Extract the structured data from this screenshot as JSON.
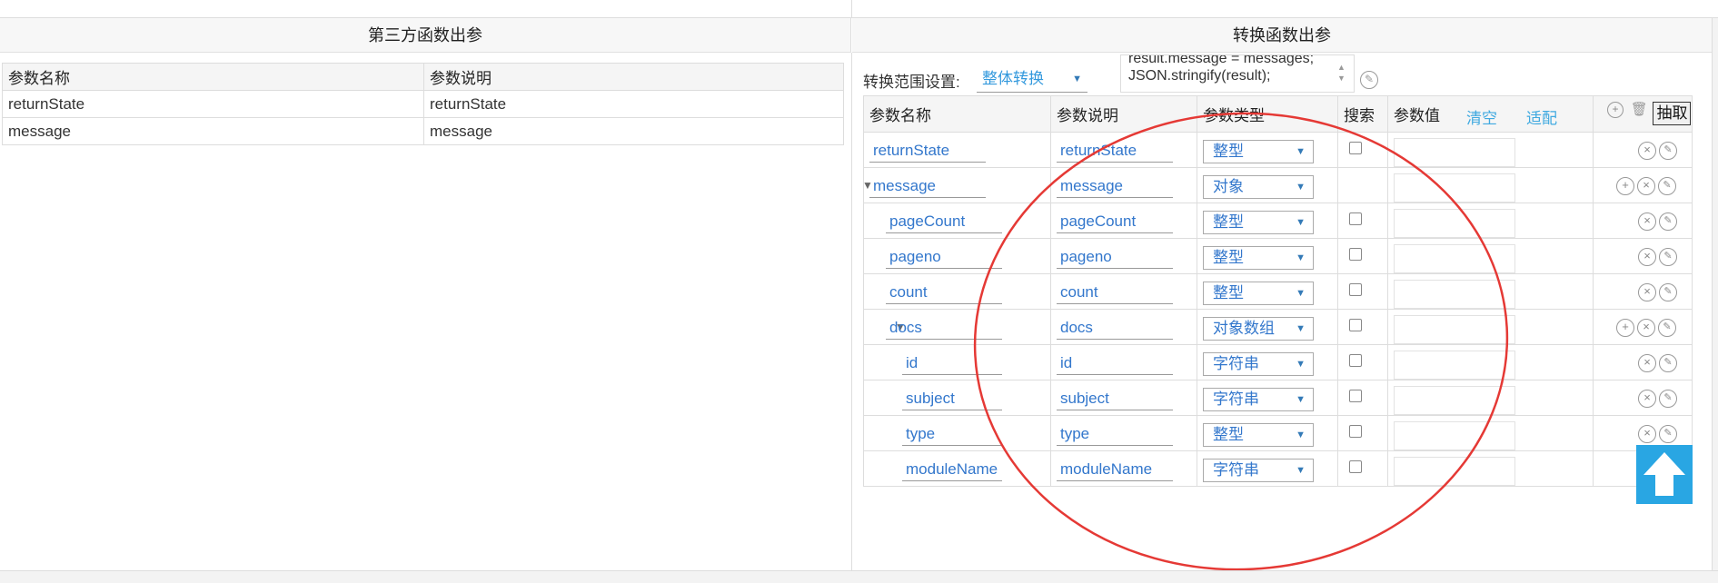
{
  "left_panel": {
    "title": "第三方函数出参",
    "columns": [
      "参数名称",
      "参数说明"
    ],
    "rows": [
      {
        "name": "returnState",
        "desc": "returnState"
      },
      {
        "name": "message",
        "desc": "message"
      }
    ]
  },
  "right_panel": {
    "title": "转换函数出参",
    "range_label": "转换范围设置:",
    "range_value": "整体转换",
    "code_line1": "result.message = messages;",
    "code_line2": "JSON.stringify(result);",
    "columns": {
      "name": "参数名称",
      "desc": "参数说明",
      "type": "参数类型",
      "search": "搜索",
      "value": "参数值",
      "clear": "清空",
      "fit": "适配",
      "extract": "抽取"
    },
    "rows": [
      {
        "name": "returnState",
        "desc": "returnState",
        "type": "整型",
        "has_checkbox": true,
        "can_add": false
      },
      {
        "name": "message",
        "desc": "message",
        "type": "对象",
        "has_checkbox": false,
        "can_add": true
      },
      {
        "name": "pageCount",
        "desc": "pageCount",
        "type": "整型",
        "has_checkbox": true,
        "can_add": false
      },
      {
        "name": "pageno",
        "desc": "pageno",
        "type": "整型",
        "has_checkbox": true,
        "can_add": false
      },
      {
        "name": "count",
        "desc": "count",
        "type": "整型",
        "has_checkbox": true,
        "can_add": false
      },
      {
        "name": "docs",
        "desc": "docs",
        "type": "对象数组",
        "has_checkbox": true,
        "can_add": true
      },
      {
        "name": "id",
        "desc": "id",
        "type": "字符串",
        "has_checkbox": true,
        "can_add": false
      },
      {
        "name": "subject",
        "desc": "subject",
        "type": "字符串",
        "has_checkbox": true,
        "can_add": false
      },
      {
        "name": "type",
        "desc": "type",
        "type": "整型",
        "has_checkbox": true,
        "can_add": false
      },
      {
        "name": "moduleName",
        "desc": "moduleName",
        "type": "字符串",
        "has_checkbox": true,
        "can_add": false
      }
    ]
  },
  "colors": {
    "annotation_ellipse": "#e53935",
    "link_blue": "#3fa9e0",
    "input_text": "#3377cc",
    "scroll_top_button": "#29a6e3"
  },
  "icons": {
    "add": "plus-circle-icon",
    "delete": "x-circle-icon",
    "edit": "pencil-circle-icon",
    "trash": "trash-icon",
    "collapse": "triangle-down-icon",
    "scroll_top": "arrow-up-icon"
  }
}
